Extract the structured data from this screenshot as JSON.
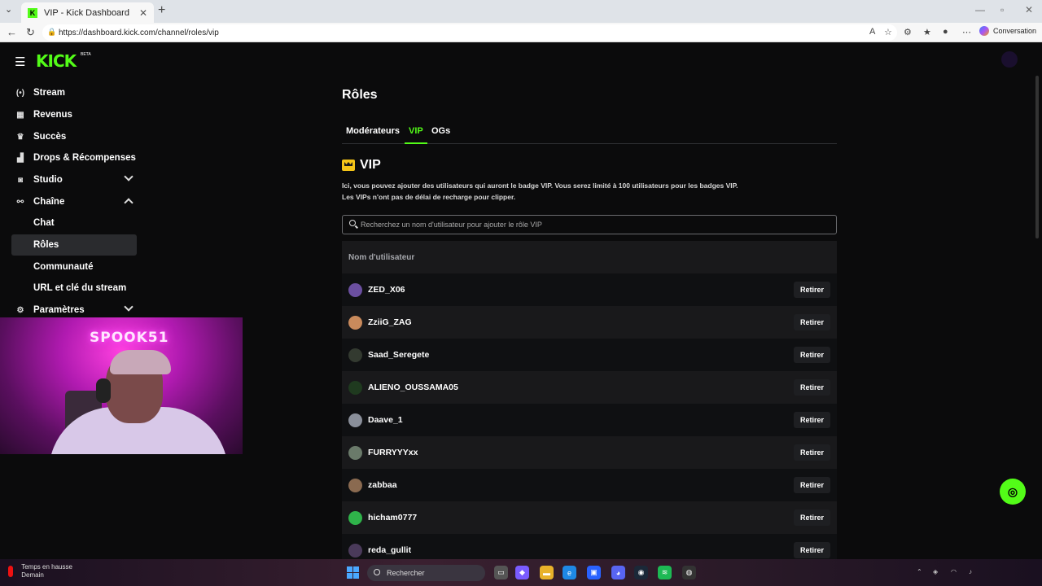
{
  "browser": {
    "tab_title": "VIP - Kick Dashboard",
    "tab_favicon_letter": "K",
    "url": "https://dashboard.kick.com/channel/roles/vip",
    "copilot_label": "Conversation"
  },
  "app": {
    "logo": "KICK",
    "logo_badge": "BETA",
    "accent_color": "#53fc18"
  },
  "sidebar": {
    "items": [
      {
        "label": "Stream",
        "icon": "broadcast-icon"
      },
      {
        "label": "Revenus",
        "icon": "revenue-icon"
      },
      {
        "label": "Succès",
        "icon": "trophy-icon"
      },
      {
        "label": "Drops & Récompenses",
        "icon": "gift-icon"
      },
      {
        "label": "Studio",
        "icon": "studio-icon"
      },
      {
        "label": "Chaîne",
        "icon": "channel-icon"
      }
    ],
    "sub_items": [
      {
        "label": "Chat"
      },
      {
        "label": "Rôles"
      },
      {
        "label": "Communauté"
      },
      {
        "label": "URL et clé du stream"
      }
    ],
    "settings": {
      "label": "Paramètres"
    }
  },
  "webcam": {
    "neon_sign": "SPOOK51"
  },
  "main": {
    "title": "Rôles",
    "tabs": [
      {
        "label": "Modérateurs"
      },
      {
        "label": "VIP"
      },
      {
        "label": "OGs"
      }
    ],
    "section_title": "VIP",
    "description_line1": "Ici, vous pouvez ajouter des utilisateurs qui auront le badge VIP. Vous serez limité à 100 utilisateurs pour les badges VIP.",
    "description_line2": "Les VIPs n'ont pas de délai de recharge pour clipper.",
    "search_placeholder": "Recherchez un nom d'utilisateur pour ajouter le rôle VIP",
    "column_header": "Nom d'utilisateur",
    "remove_label": "Retirer",
    "users": [
      {
        "name": "ZED_X06",
        "avatar_color": "#6b4fa0"
      },
      {
        "name": "ZziiG_ZAG",
        "avatar_color": "#c98a5c"
      },
      {
        "name": "Saad_Seregete",
        "avatar_color": "#333a30"
      },
      {
        "name": "ALIENO_OUSSAMA05",
        "avatar_color": "#1f3a1f"
      },
      {
        "name": "Daave_1",
        "avatar_color": "#8a8f9a"
      },
      {
        "name": "FURRYYYxx",
        "avatar_color": "#6a7a6a"
      },
      {
        "name": "zabbaa",
        "avatar_color": "#8a6a50"
      },
      {
        "name": "hicham0777",
        "avatar_color": "#2fb34a"
      },
      {
        "name": "reda_gullit",
        "avatar_color": "#4a3a5a"
      }
    ]
  },
  "taskbar": {
    "weather_line1": "Temps en hausse",
    "weather_line2": "Demain",
    "search_label": "Rechercher"
  }
}
